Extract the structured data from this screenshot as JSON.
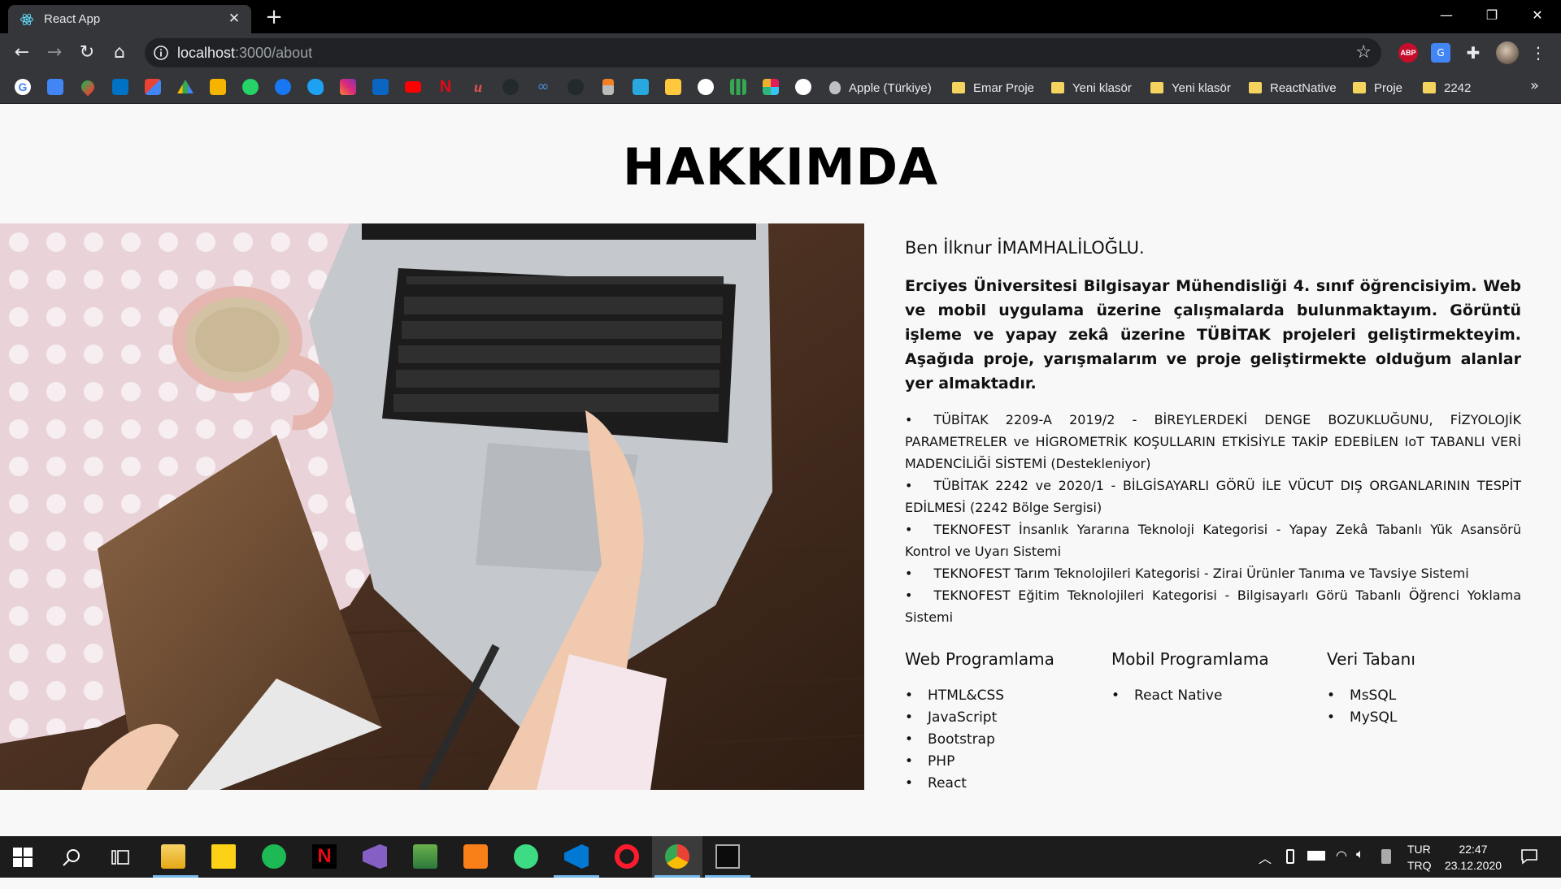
{
  "browser": {
    "tab_title": "React App",
    "new_tab_symbol": "+",
    "url_host": "localhost",
    "url_rest": ":3000/about",
    "window_controls": [
      "minimize",
      "maximize",
      "close"
    ],
    "extensions": {
      "abp_label": "ABP"
    }
  },
  "bookmarks": {
    "folders": [
      {
        "label": "Apple (Türkiye)",
        "icon": "apple-icon"
      },
      {
        "label": "Emar Proje",
        "icon": "folder-icon"
      },
      {
        "label": "Yeni klasör",
        "icon": "folder-icon"
      },
      {
        "label": "Yeni klasör",
        "icon": "folder-icon"
      },
      {
        "label": "ReactNative",
        "icon": "folder-icon"
      },
      {
        "label": "Proje",
        "icon": "folder-icon"
      },
      {
        "label": "2242",
        "icon": "folder-icon"
      }
    ],
    "more_label": "»"
  },
  "page": {
    "title": "HAKKIMDA",
    "intro_name": "Ben İlknur İMAMHALİLOĞLU.",
    "intro_bio": "Erciyes Üniversitesi Bilgisayar Mühendisliği 4. sınıf öğrencisiyim. Web ve mobil uygulama üzerine çalışmalarda bulunmaktayım. Görüntü işleme ve yapay zekâ üzerine TÜBİTAK projeleri geliştirmekteyim. Aşağıda proje, yarışmalarım ve proje geliştirmekte olduğum alanlar yer almaktadır.",
    "projects": [
      "TÜBİTAK 2209-A 2019/2 - BİREYLERDEKİ DENGE BOZUKLUĞUNU, FİZYOLOJİK PARAMETRELER ve HİGROMETRİK KOŞULLARIN ETKİSİYLE TAKİP EDEBİLEN IoT TABANLI VERİ MADENCİLİĞİ SİSTEMİ (Destekleniyor)",
      "TÜBİTAK 2242 ve 2020/1 - BİLGİSAYARLI GÖRÜ İLE VÜCUT DIŞ ORGANLARININ TESPİT EDİLMESİ (2242 Bölge Sergisi)",
      "TEKNOFEST İnsanlık Yararına Teknoloji Kategorisi - Yapay Zekâ Tabanlı Yük Asansörü Kontrol ve Uyarı Sistemi",
      "TEKNOFEST Tarım Teknolojileri Kategorisi - Zirai Ürünler Tanıma ve Tavsiye Sistemi",
      "TEKNOFEST Eğitim Teknolojileri Kategorisi - Bilgisayarlı Görü Tabanlı Öğrenci Yoklama Sistemi"
    ],
    "skills": [
      {
        "heading": "Web Programlama",
        "items": [
          "HTML&CSS",
          "JavaScript",
          "Bootstrap",
          "PHP",
          "React"
        ]
      },
      {
        "heading": "Mobil Programlama",
        "items": [
          "React Native"
        ]
      },
      {
        "heading": "Veri Tabanı",
        "items": [
          "MsSQL",
          "MySQL"
        ]
      }
    ]
  },
  "taskbar": {
    "language": "TUR",
    "keyboard": "TRQ",
    "time": "22:47",
    "date": "23.12.2020"
  }
}
